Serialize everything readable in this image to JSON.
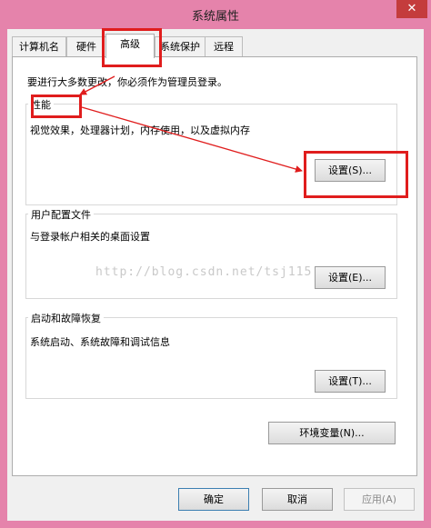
{
  "window": {
    "title": "系统属性",
    "close_glyph": "✕"
  },
  "tabs": [
    {
      "label": "计算机名"
    },
    {
      "label": "硬件"
    },
    {
      "label": "高级"
    },
    {
      "label": "系统保护"
    },
    {
      "label": "远程"
    }
  ],
  "admin_note": "要进行大多数更改，你必须作为管理员登录。",
  "performance": {
    "title": "性能",
    "description": "视觉效果，处理器计划，内存使用，以及虚拟内存",
    "button": "设置(S)..."
  },
  "user_profiles": {
    "title": "用户配置文件",
    "description": "与登录帐户相关的桌面设置",
    "button": "设置(E)..."
  },
  "startup_recovery": {
    "title": "启动和故障恢复",
    "description": "系统启动、系统故障和调试信息",
    "button": "设置(T)..."
  },
  "env_button": "环境变量(N)...",
  "footer": {
    "ok": "确定",
    "cancel": "取消",
    "apply": "应用(A)"
  },
  "watermark": "http://blog.csdn.net/tsj115",
  "colors": {
    "annotation": "#e01d1d",
    "frame": "#e583ab"
  }
}
